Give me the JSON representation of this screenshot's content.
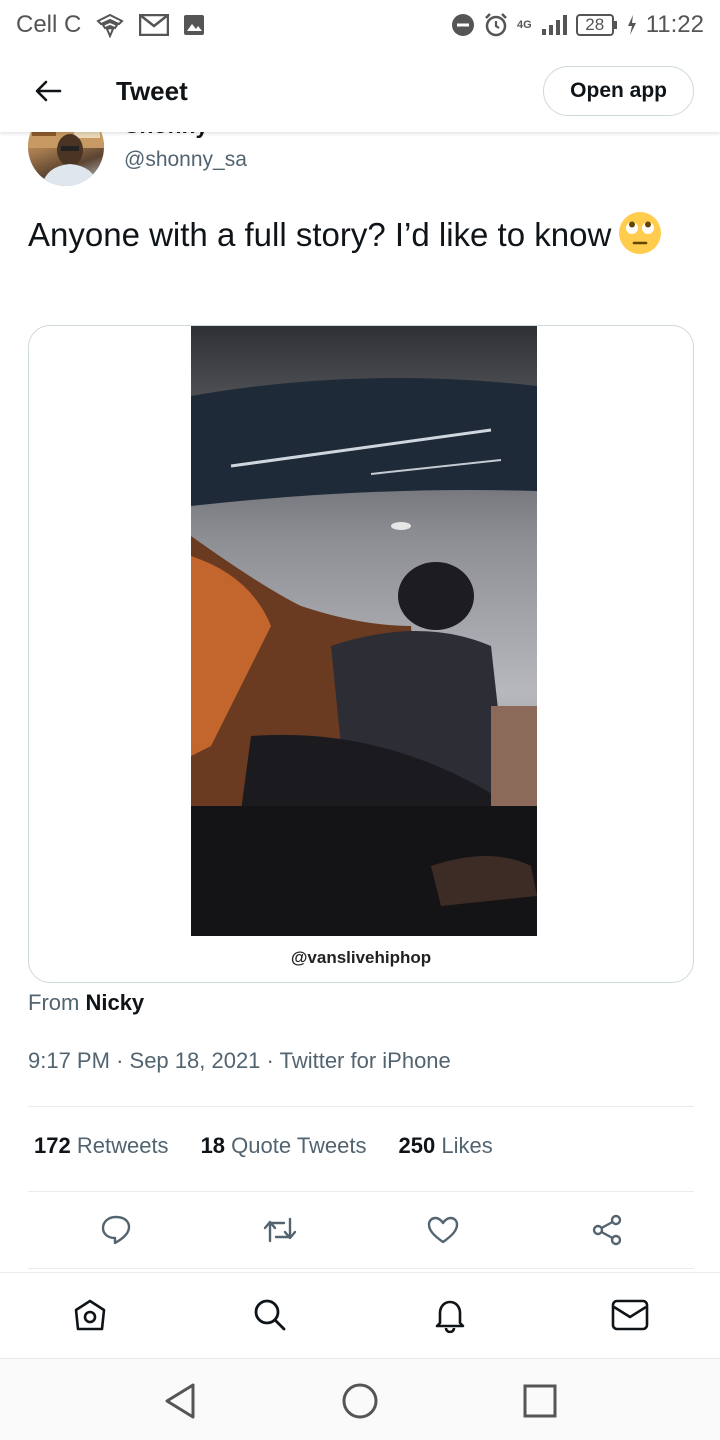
{
  "status_bar": {
    "carrier": "Cell C",
    "network": "4G",
    "battery": "28",
    "time": "11:22",
    "icons": [
      "carrier-logo-icon",
      "mail-icon",
      "image-icon",
      "dnd-icon",
      "alarm-icon",
      "signal-icon",
      "battery-icon",
      "charging-icon"
    ]
  },
  "header": {
    "title": "Tweet",
    "open_app_label": "Open app"
  },
  "tweet": {
    "display_name": "Shonny",
    "handle": "@shonny_sa",
    "text": "Anyone with a full story? I’d like to know",
    "media_watermark": "@vanslivehiphop",
    "from_prefix": "From",
    "from_name": "Nicky",
    "time": "9:17 PM",
    "date": "Sep 18, 2021",
    "source": "Twitter for iPhone",
    "separator": "·"
  },
  "stats": {
    "retweets_count": "172",
    "retweets_label": "Retweets",
    "quotes_count": "18",
    "quotes_label": "Quote Tweets",
    "likes_count": "250",
    "likes_label": "Likes"
  },
  "colors": {
    "text_primary": "#0f1419",
    "text_secondary": "#536471",
    "divider": "#e6ecf0"
  }
}
